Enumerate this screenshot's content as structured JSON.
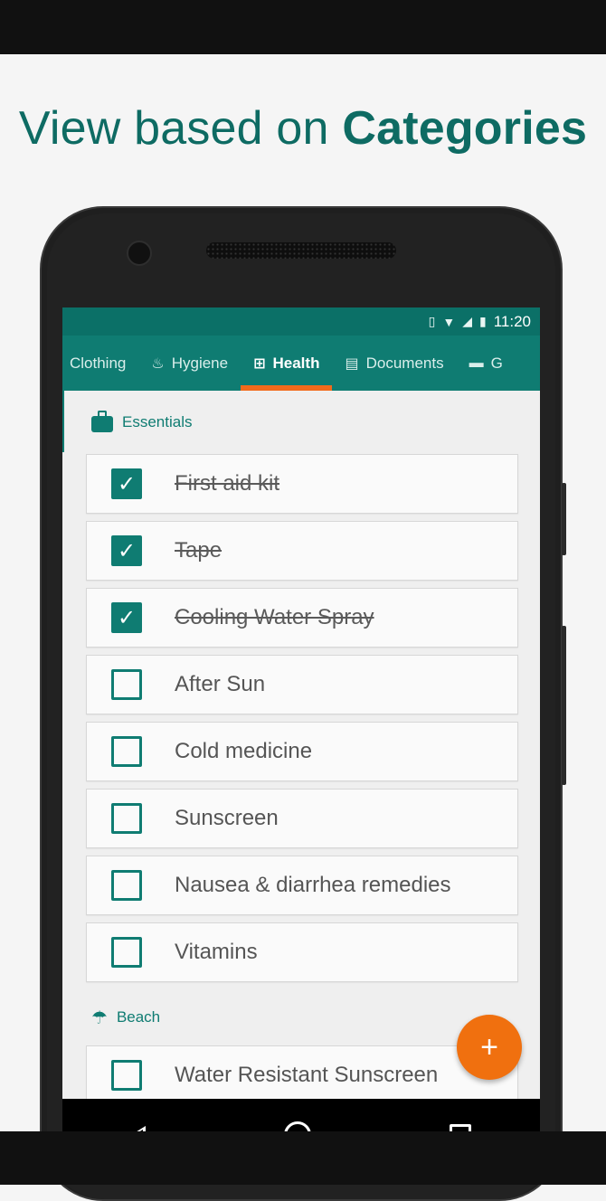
{
  "headline": {
    "regular": "View based on ",
    "bold": "Categories"
  },
  "statusbar": {
    "time": "11:20",
    "icons": [
      "vibrate-icon",
      "wifi-icon",
      "signal-icon",
      "battery-icon"
    ]
  },
  "tabs": [
    {
      "label": "Clothing",
      "icon": "shirt-icon",
      "active": false
    },
    {
      "label": "Hygiene",
      "icon": "sink-icon",
      "active": false
    },
    {
      "label": "Health",
      "icon": "first-aid-icon",
      "active": true
    },
    {
      "label": "Documents",
      "icon": "documents-icon",
      "active": false
    },
    {
      "label": "G",
      "icon": "gamepad-icon",
      "active": false
    }
  ],
  "sections": [
    {
      "title": "Essentials",
      "icon": "briefcase-icon",
      "items": [
        {
          "label": "First aid kit",
          "checked": true
        },
        {
          "label": "Tape",
          "checked": true
        },
        {
          "label": "Cooling Water Spray",
          "checked": true
        },
        {
          "label": "After Sun",
          "checked": false
        },
        {
          "label": "Cold medicine",
          "checked": false
        },
        {
          "label": "Sunscreen",
          "checked": false
        },
        {
          "label": "Nausea & diarrhea remedies",
          "checked": false
        },
        {
          "label": "Vitamins",
          "checked": false
        }
      ]
    },
    {
      "title": "Beach",
      "icon": "umbrella-icon",
      "items": [
        {
          "label": "Water Resistant Sunscreen",
          "checked": false
        }
      ]
    }
  ],
  "fab": {
    "label": "+"
  },
  "colors": {
    "teal": "#0f7c72",
    "teal_dark": "#0b7067",
    "accent": "#f26a1b",
    "fab": "#f0700f"
  }
}
